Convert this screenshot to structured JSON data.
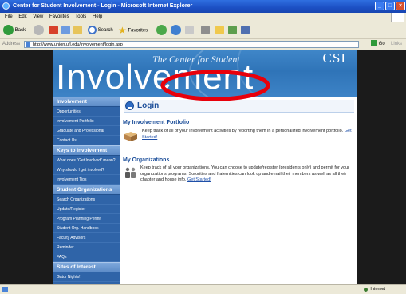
{
  "window": {
    "title": "Center for Student Involvement - Login - Microsoft Internet Explorer",
    "controls": {
      "minimize": "_",
      "maximize": "□",
      "close": "×"
    }
  },
  "menubar": {
    "items": [
      "File",
      "Edit",
      "View",
      "Favorites",
      "Tools",
      "Help"
    ]
  },
  "toolbar": {
    "back": "Back",
    "search": "Search",
    "favorites": "Favorites"
  },
  "addressbar": {
    "label": "Address",
    "url": "http://www.union.ufl.edu/involvement/login.asp",
    "go": "Go",
    "links": "Links"
  },
  "site": {
    "banner": {
      "subtitle": "The Center for Student",
      "title": "Involvement",
      "logo": "CSI"
    },
    "sidebar": {
      "sections": [
        {
          "heading": "Involvement",
          "items": [
            "Opportunities",
            "Involvement Portfolio",
            "Graduate and Professional",
            "Contact Us"
          ]
        },
        {
          "heading": "Keys to Involvement",
          "items": [
            "What does \"Get Involved\" mean?",
            "Why should I get involved?",
            "Involvement Tips"
          ]
        },
        {
          "heading": "Student Organizations",
          "items": [
            "Search Organizations",
            "Update/Register",
            "Program Planning/Permit",
            "Student Org. Handbook",
            "Faculty Advisors",
            "Reminder",
            "FAQs"
          ]
        },
        {
          "heading": "Sites of Interest",
          "items": [
            "Gator Nights!"
          ]
        }
      ]
    },
    "content": {
      "login_title": "Login",
      "portfolio": {
        "title": "My Involvement Portfolio",
        "text": "Keep track of all of your involvement activities by reporting them in a personalized involvement portfolio.",
        "link": "Get Started!"
      },
      "organizations": {
        "title": "My Organizations",
        "text": "Keep track of all your organizations. You can choose to update/register (presidents only) and permit for your organizations programs. Sororities and fraternities can look up and email their members as well as all their chapter and house info.",
        "link": "Get Started!"
      }
    }
  },
  "statusbar": {
    "zone": "Internet"
  },
  "colors": {
    "annotation_ellipse": "#e8000b",
    "banner_blue": "#3f86c8",
    "sidebar_blue": "#2f64a8"
  }
}
